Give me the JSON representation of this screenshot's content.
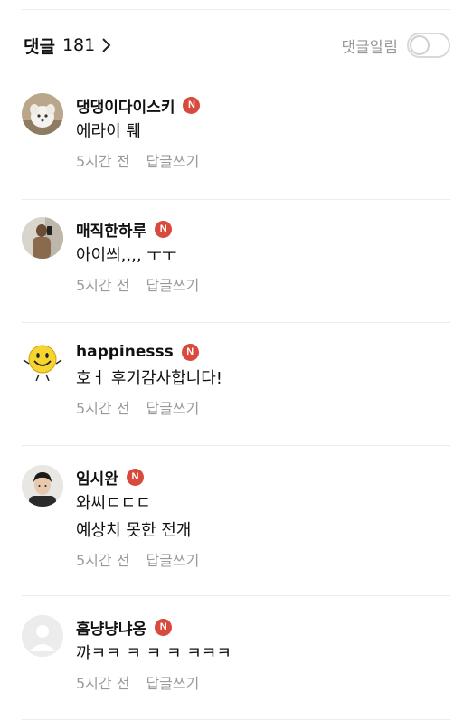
{
  "header": {
    "title": "댓글",
    "count": "181",
    "notify_label": "댓글알림",
    "notify_on": false
  },
  "comments": [
    {
      "author": "댕댕이다이스키",
      "badge": "N",
      "text": "에라이 퉤",
      "time": "5시간 전",
      "reply_label": "답글쓰기",
      "avatar": "dog-photo"
    },
    {
      "author": "매직한하루",
      "badge": "N",
      "text": "아이씌,,,, ㅜㅜ",
      "time": "5시간 전",
      "reply_label": "답글쓰기",
      "avatar": "mirror-selfie-photo"
    },
    {
      "author": "happinesss",
      "badge": "N",
      "text": "호ㅓ 후기감사합니다!",
      "time": "5시간 전",
      "reply_label": "답글쓰기",
      "avatar": "smiley-face"
    },
    {
      "author": "임시완",
      "badge": "N",
      "text": "와씨ㄷㄷㄷ\n예상치 못한 전개",
      "time": "5시간 전",
      "reply_label": "답글쓰기",
      "avatar": "person-photo"
    },
    {
      "author": "흠냥냥냐옹",
      "badge": "N",
      "text": "꺄ㅋㅋ ㅋ ㅋ ㅋ ㅋㅋㅋ",
      "time": "5시간 전",
      "reply_label": "답글쓰기",
      "avatar": "default-avatar"
    }
  ],
  "colors": {
    "badge": "#d84a3c",
    "muted": "#9a9a9a",
    "divider": "#ececec"
  }
}
